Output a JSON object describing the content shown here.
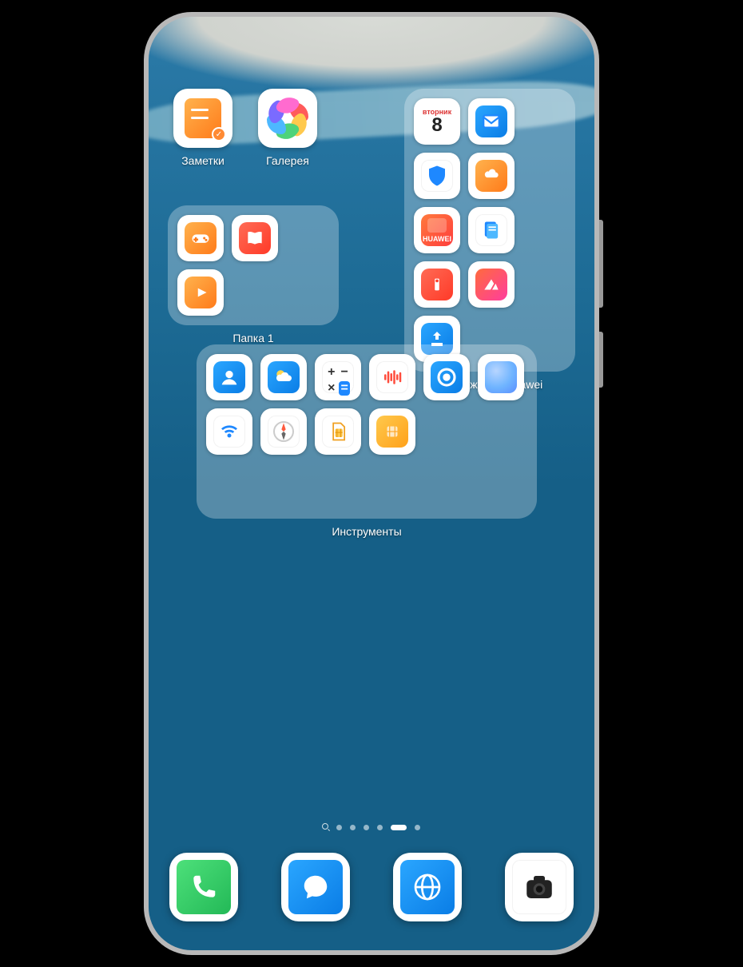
{
  "apps": {
    "notes": {
      "label": "Заметки"
    },
    "gallery": {
      "label": "Галерея"
    }
  },
  "folder_small": {
    "label": "Папка 1",
    "icons": [
      "gamepad-icon",
      "book-icon",
      "video-icon"
    ]
  },
  "folder_huawei": {
    "label": "Приложения Huawei",
    "calendar": {
      "dow": "вторник",
      "dom": "8"
    },
    "huawei_text": "HUAWEI",
    "icons": [
      "calendar-icon",
      "mail-icon",
      "shield-icon",
      "cloud-folder-icon",
      "huawei-store-icon",
      "documents-icon",
      "tips-icon",
      "petal-icon",
      "share-icon"
    ]
  },
  "folder_tools": {
    "label": "Инструменты",
    "icons": [
      "contacts-icon",
      "weather-icon",
      "calculator-icon",
      "recorder-icon",
      "find-device-icon",
      "lens-icon",
      "remote-icon",
      "compass-icon",
      "sim1-icon",
      "sim2-icon"
    ]
  },
  "page_dots": {
    "total": 7,
    "active_index": 5
  },
  "dock": {
    "icons": [
      "phone-icon",
      "messages-icon",
      "browser-icon",
      "camera-icon"
    ]
  }
}
